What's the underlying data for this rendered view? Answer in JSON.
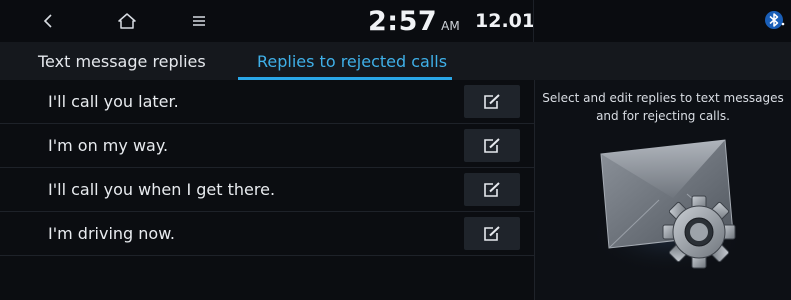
{
  "status_bar": {
    "time": "2:57",
    "ampm": "AM",
    "date": "12.01",
    "icons": [
      "back-icon",
      "home-icon",
      "menu-icon",
      "bluetooth-icon"
    ]
  },
  "tabs": [
    {
      "label": "Text message replies",
      "active": false
    },
    {
      "label": "Replies to rejected calls",
      "active": true
    }
  ],
  "replies": [
    {
      "label": "I'll call you later.",
      "action_icon": "edit-icon"
    },
    {
      "label": "I'm on my way.",
      "action_icon": "edit-icon"
    },
    {
      "label": "I'll call you when I get there.",
      "action_icon": "edit-icon"
    },
    {
      "label": "I'm driving now.",
      "action_icon": "edit-icon"
    }
  ],
  "info_panel": {
    "line1": "Select and edit replies to text messages",
    "line2": "and for rejecting calls.",
    "illustration": "envelope-gear-icon"
  },
  "colors": {
    "background": "#0b0d11",
    "tab_bar": "#15181d",
    "accent": "#2aa7e8",
    "edit_button": "#1f242b"
  }
}
